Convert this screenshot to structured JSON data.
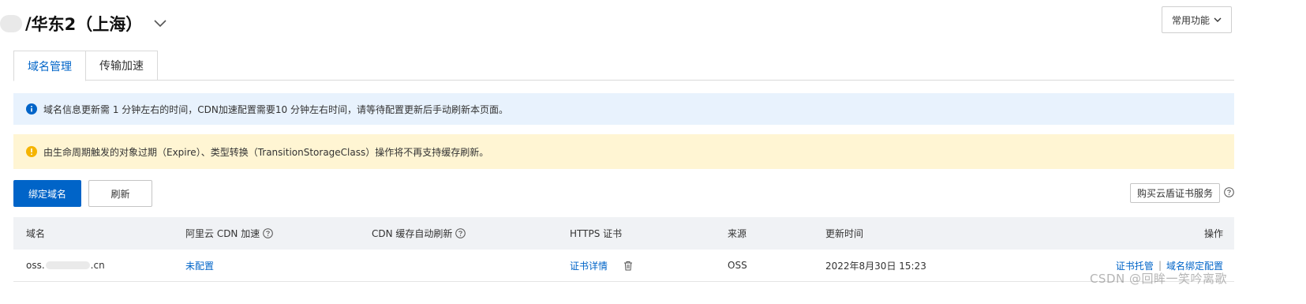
{
  "header": {
    "title_prefix": "/ ",
    "title": "华东2（上海）",
    "common_functions": "常用功能"
  },
  "tabs": [
    {
      "label": "域名管理",
      "active": true
    },
    {
      "label": "传输加速",
      "active": false
    }
  ],
  "alerts": {
    "info": "域名信息更新需 1 分钟左右的时间，CDN加速配置需要10 分钟左右时间，请等待配置更新后手动刷新本页面。",
    "warning": "由生命周期触发的对象过期（Expire）、类型转换（TransitionStorageClass）操作将不再支持缓存刷新。"
  },
  "toolbar": {
    "bind_domain": "绑定域名",
    "refresh": "刷新",
    "buy_cert": "购买云盾证书服务"
  },
  "table": {
    "columns": [
      "域名",
      "阿里云 CDN 加速",
      "CDN 缓存自动刷新",
      "HTTPS 证书",
      "来源",
      "更新时间",
      "操作"
    ],
    "rows": [
      {
        "domain_prefix": "oss.",
        "domain_suffix": ".cn",
        "cdn": "未配置",
        "cert": "证书详情",
        "source": "OSS",
        "updated": "2022年8月30日 15:23",
        "action_1": "证书托管",
        "action_sep": "|",
        "action_2": "域名绑定配置"
      }
    ]
  },
  "watermark": "CSDN @回眸一笑吟离歌",
  "colors": {
    "primary": "#0064c8",
    "info_bg": "#e8f2fd",
    "warn_bg": "#fff5d3",
    "warn_icon": "#f5b400",
    "table_head": "#f0f2f5"
  }
}
